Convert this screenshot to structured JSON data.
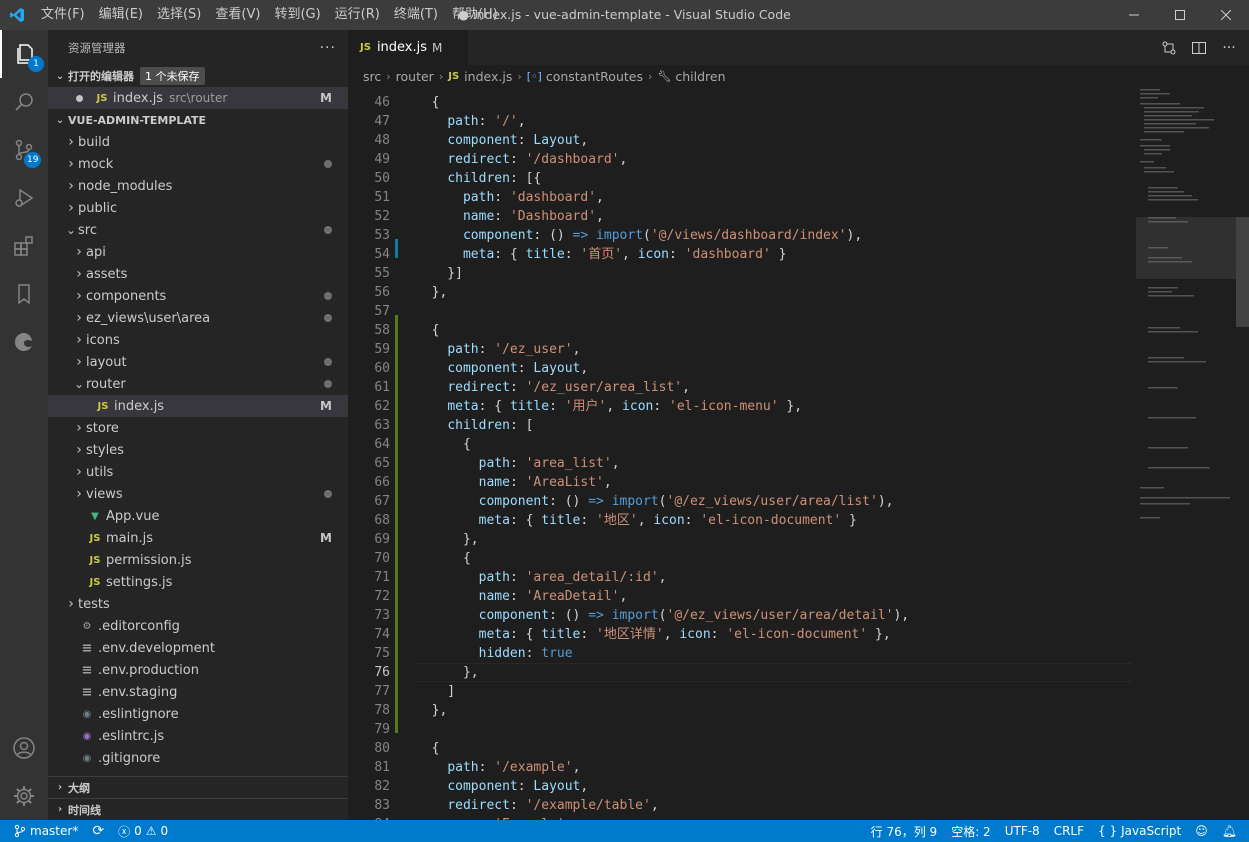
{
  "titlebar": {
    "menus": [
      "文件(F)",
      "编辑(E)",
      "选择(S)",
      "查看(V)",
      "转到(G)",
      "运行(R)",
      "终端(T)",
      "帮助(H)"
    ],
    "window_title": "● index.js - vue-admin-template - Visual Studio Code"
  },
  "activity": {
    "explorer_badge": "1",
    "scm_badge": "19"
  },
  "sidebar": {
    "header": "资源管理器",
    "open_editors_title": "打开的编辑器",
    "unsaved_badge": "1 个未保存",
    "open_editor_name": "index.js",
    "open_editor_path": "src\\router",
    "open_editor_flag": "M",
    "project_title": "VUE-ADMIN-TEMPLATE",
    "tree": [
      {
        "name": "build",
        "type": "folder"
      },
      {
        "name": "mock",
        "type": "folder",
        "dot": true
      },
      {
        "name": "node_modules",
        "type": "folder"
      },
      {
        "name": "public",
        "type": "folder"
      },
      {
        "name": "src",
        "type": "folder-open",
        "dot": true
      },
      {
        "name": "api",
        "type": "folder"
      },
      {
        "name": "assets",
        "type": "folder"
      },
      {
        "name": "components",
        "type": "folder",
        "dot": true
      },
      {
        "name": "ez_views\\user\\area",
        "type": "folder",
        "dot": true
      },
      {
        "name": "icons",
        "type": "folder"
      },
      {
        "name": "layout",
        "type": "folder",
        "dot": true
      },
      {
        "name": "router",
        "type": "folder-open",
        "dot": true
      },
      {
        "name": "index.js",
        "type": "js",
        "flag": "M"
      },
      {
        "name": "store",
        "type": "folder"
      },
      {
        "name": "styles",
        "type": "folder"
      },
      {
        "name": "utils",
        "type": "folder"
      },
      {
        "name": "views",
        "type": "folder",
        "dot": true
      },
      {
        "name": "App.vue",
        "type": "vue"
      },
      {
        "name": "main.js",
        "type": "js",
        "flag": "M"
      },
      {
        "name": "permission.js",
        "type": "js"
      },
      {
        "name": "settings.js",
        "type": "js"
      },
      {
        "name": "tests",
        "type": "folder"
      },
      {
        "name": ".editorconfig",
        "type": "gear"
      },
      {
        "name": ".env.development",
        "type": "lines"
      },
      {
        "name": ".env.production",
        "type": "lines"
      },
      {
        "name": ".env.staging",
        "type": "lines"
      },
      {
        "name": ".eslintignore",
        "type": "circle"
      },
      {
        "name": ".eslintrc.js",
        "type": "eslint"
      },
      {
        "name": ".gitignore",
        "type": "circle"
      }
    ],
    "outline_title": "大纲",
    "timeline_title": "时间线"
  },
  "editor": {
    "tab_name": "index.js",
    "tab_flag": "M",
    "breadcrumbs": [
      "src",
      "router",
      "index.js",
      "constantRoutes",
      "children"
    ],
    "lines": [
      {
        "n": "46",
        "t": [
          [
            "p",
            "  {"
          ]
        ]
      },
      {
        "n": "47",
        "t": [
          [
            "p",
            "    "
          ],
          [
            "k",
            "path"
          ],
          [
            "p",
            ": "
          ],
          [
            "s",
            "'/'"
          ],
          [
            "p",
            ","
          ]
        ]
      },
      {
        "n": "48",
        "t": [
          [
            "p",
            "    "
          ],
          [
            "k",
            "component"
          ],
          [
            "p",
            ": "
          ],
          [
            "k",
            "Layout"
          ],
          [
            "p",
            ","
          ]
        ]
      },
      {
        "n": "49",
        "t": [
          [
            "p",
            "    "
          ],
          [
            "k",
            "redirect"
          ],
          [
            "p",
            ": "
          ],
          [
            "s",
            "'/dashboard'"
          ],
          [
            "p",
            ","
          ]
        ]
      },
      {
        "n": "50",
        "t": [
          [
            "p",
            "    "
          ],
          [
            "k",
            "children"
          ],
          [
            "p",
            ": [{"
          ]
        ]
      },
      {
        "n": "51",
        "t": [
          [
            "p",
            "      "
          ],
          [
            "k",
            "path"
          ],
          [
            "p",
            ": "
          ],
          [
            "s",
            "'dashboard'"
          ],
          [
            "p",
            ","
          ]
        ]
      },
      {
        "n": "52",
        "t": [
          [
            "p",
            "      "
          ],
          [
            "k",
            "name"
          ],
          [
            "p",
            ": "
          ],
          [
            "s",
            "'Dashboard'"
          ],
          [
            "p",
            ","
          ]
        ]
      },
      {
        "n": "53",
        "t": [
          [
            "p",
            "      "
          ],
          [
            "k",
            "component"
          ],
          [
            "p",
            ": () "
          ],
          [
            "w",
            "=>"
          ],
          [
            "p",
            " "
          ],
          [
            "w",
            "import"
          ],
          [
            "p",
            "("
          ],
          [
            "s",
            "'@/views/dashboard/index'"
          ],
          [
            "p",
            "),"
          ]
        ]
      },
      {
        "n": "54",
        "t": [
          [
            "p",
            "      "
          ],
          [
            "k",
            "meta"
          ],
          [
            "p",
            ": { "
          ],
          [
            "k",
            "title"
          ],
          [
            "p",
            ": "
          ],
          [
            "s",
            "'首页'"
          ],
          [
            "p",
            ", "
          ],
          [
            "k",
            "icon"
          ],
          [
            "p",
            ": "
          ],
          [
            "s",
            "'dashboard'"
          ],
          [
            "p",
            " }"
          ]
        ]
      },
      {
        "n": "55",
        "t": [
          [
            "p",
            "    }]"
          ]
        ]
      },
      {
        "n": "56",
        "t": [
          [
            "p",
            "  },"
          ]
        ]
      },
      {
        "n": "57",
        "t": []
      },
      {
        "n": "58",
        "t": [
          [
            "p",
            "  {"
          ]
        ]
      },
      {
        "n": "59",
        "t": [
          [
            "p",
            "    "
          ],
          [
            "k",
            "path"
          ],
          [
            "p",
            ": "
          ],
          [
            "s",
            "'/ez_user'"
          ],
          [
            "p",
            ","
          ]
        ]
      },
      {
        "n": "60",
        "t": [
          [
            "p",
            "    "
          ],
          [
            "k",
            "component"
          ],
          [
            "p",
            ": "
          ],
          [
            "k",
            "Layout"
          ],
          [
            "p",
            ","
          ]
        ]
      },
      {
        "n": "61",
        "t": [
          [
            "p",
            "    "
          ],
          [
            "k",
            "redirect"
          ],
          [
            "p",
            ": "
          ],
          [
            "s",
            "'/ez_user/area_list'"
          ],
          [
            "p",
            ","
          ]
        ]
      },
      {
        "n": "62",
        "t": [
          [
            "p",
            "    "
          ],
          [
            "k",
            "meta"
          ],
          [
            "p",
            ": { "
          ],
          [
            "k",
            "title"
          ],
          [
            "p",
            ": "
          ],
          [
            "s",
            "'用户'"
          ],
          [
            "p",
            ", "
          ],
          [
            "k",
            "icon"
          ],
          [
            "p",
            ": "
          ],
          [
            "s",
            "'el-icon-menu'"
          ],
          [
            "p",
            " },"
          ]
        ]
      },
      {
        "n": "63",
        "t": [
          [
            "p",
            "    "
          ],
          [
            "k",
            "children"
          ],
          [
            "p",
            ": ["
          ]
        ]
      },
      {
        "n": "64",
        "t": [
          [
            "p",
            "      {"
          ]
        ]
      },
      {
        "n": "65",
        "t": [
          [
            "p",
            "        "
          ],
          [
            "k",
            "path"
          ],
          [
            "p",
            ": "
          ],
          [
            "s",
            "'area_list'"
          ],
          [
            "p",
            ","
          ]
        ]
      },
      {
        "n": "66",
        "t": [
          [
            "p",
            "        "
          ],
          [
            "k",
            "name"
          ],
          [
            "p",
            ": "
          ],
          [
            "s",
            "'AreaList'"
          ],
          [
            "p",
            ","
          ]
        ]
      },
      {
        "n": "67",
        "t": [
          [
            "p",
            "        "
          ],
          [
            "k",
            "component"
          ],
          [
            "p",
            ": () "
          ],
          [
            "w",
            "=>"
          ],
          [
            "p",
            " "
          ],
          [
            "w",
            "import"
          ],
          [
            "p",
            "("
          ],
          [
            "s",
            "'@/ez_views/user/area/list'"
          ],
          [
            "p",
            "),"
          ]
        ]
      },
      {
        "n": "68",
        "t": [
          [
            "p",
            "        "
          ],
          [
            "k",
            "meta"
          ],
          [
            "p",
            ": { "
          ],
          [
            "k",
            "title"
          ],
          [
            "p",
            ": "
          ],
          [
            "s",
            "'地区'"
          ],
          [
            "p",
            ", "
          ],
          [
            "k",
            "icon"
          ],
          [
            "p",
            ": "
          ],
          [
            "s",
            "'el-icon-document'"
          ],
          [
            "p",
            " }"
          ]
        ]
      },
      {
        "n": "69",
        "t": [
          [
            "p",
            "      },"
          ]
        ]
      },
      {
        "n": "70",
        "t": [
          [
            "p",
            "      {"
          ]
        ]
      },
      {
        "n": "71",
        "t": [
          [
            "p",
            "        "
          ],
          [
            "k",
            "path"
          ],
          [
            "p",
            ": "
          ],
          [
            "s",
            "'area_detail/:id'"
          ],
          [
            "p",
            ","
          ]
        ]
      },
      {
        "n": "72",
        "t": [
          [
            "p",
            "        "
          ],
          [
            "k",
            "name"
          ],
          [
            "p",
            ": "
          ],
          [
            "s",
            "'AreaDetail'"
          ],
          [
            "p",
            ","
          ]
        ]
      },
      {
        "n": "73",
        "t": [
          [
            "p",
            "        "
          ],
          [
            "k",
            "component"
          ],
          [
            "p",
            ": () "
          ],
          [
            "w",
            "=>"
          ],
          [
            "p",
            " "
          ],
          [
            "w",
            "import"
          ],
          [
            "p",
            "("
          ],
          [
            "s",
            "'@/ez_views/user/area/detail'"
          ],
          [
            "p",
            "),"
          ]
        ]
      },
      {
        "n": "74",
        "t": [
          [
            "p",
            "        "
          ],
          [
            "k",
            "meta"
          ],
          [
            "p",
            ": { "
          ],
          [
            "k",
            "title"
          ],
          [
            "p",
            ": "
          ],
          [
            "s",
            "'地区详情'"
          ],
          [
            "p",
            ", "
          ],
          [
            "k",
            "icon"
          ],
          [
            "p",
            ": "
          ],
          [
            "s",
            "'el-icon-document'"
          ],
          [
            "p",
            " },"
          ]
        ]
      },
      {
        "n": "75",
        "t": [
          [
            "p",
            "        "
          ],
          [
            "k",
            "hidden"
          ],
          [
            "p",
            ": "
          ],
          [
            "w",
            "true"
          ]
        ]
      },
      {
        "n": "76",
        "t": [
          [
            "p",
            "      },"
          ]
        ]
      },
      {
        "n": "77",
        "t": [
          [
            "p",
            "    ]"
          ]
        ]
      },
      {
        "n": "78",
        "t": [
          [
            "p",
            "  },"
          ]
        ]
      },
      {
        "n": "79",
        "t": []
      },
      {
        "n": "80",
        "t": [
          [
            "p",
            "  {"
          ]
        ]
      },
      {
        "n": "81",
        "t": [
          [
            "p",
            "    "
          ],
          [
            "k",
            "path"
          ],
          [
            "p",
            ": "
          ],
          [
            "s",
            "'/example'"
          ],
          [
            "p",
            ","
          ]
        ]
      },
      {
        "n": "82",
        "t": [
          [
            "p",
            "    "
          ],
          [
            "k",
            "component"
          ],
          [
            "p",
            ": "
          ],
          [
            "k",
            "Layout"
          ],
          [
            "p",
            ","
          ]
        ]
      },
      {
        "n": "83",
        "t": [
          [
            "p",
            "    "
          ],
          [
            "k",
            "redirect"
          ],
          [
            "p",
            ": "
          ],
          [
            "s",
            "'/example/table'"
          ],
          [
            "p",
            ","
          ]
        ]
      },
      {
        "n": "84",
        "t": [
          [
            "p",
            "    "
          ],
          [
            "k",
            "name"
          ],
          [
            "p",
            ": "
          ],
          [
            "s",
            "'Example'"
          ],
          [
            "p",
            ","
          ]
        ]
      }
    ],
    "current_line": "76"
  },
  "statusbar": {
    "branch": "master*",
    "errors": "0",
    "warnings": "0",
    "cursor": "行 76，列 9",
    "spaces": "空格: 2",
    "encoding": "UTF-8",
    "eol": "CRLF",
    "language": "JavaScript"
  },
  "colors": {
    "accent": "#007acc",
    "added": "#587c0c",
    "modified": "#0c7d9d"
  }
}
